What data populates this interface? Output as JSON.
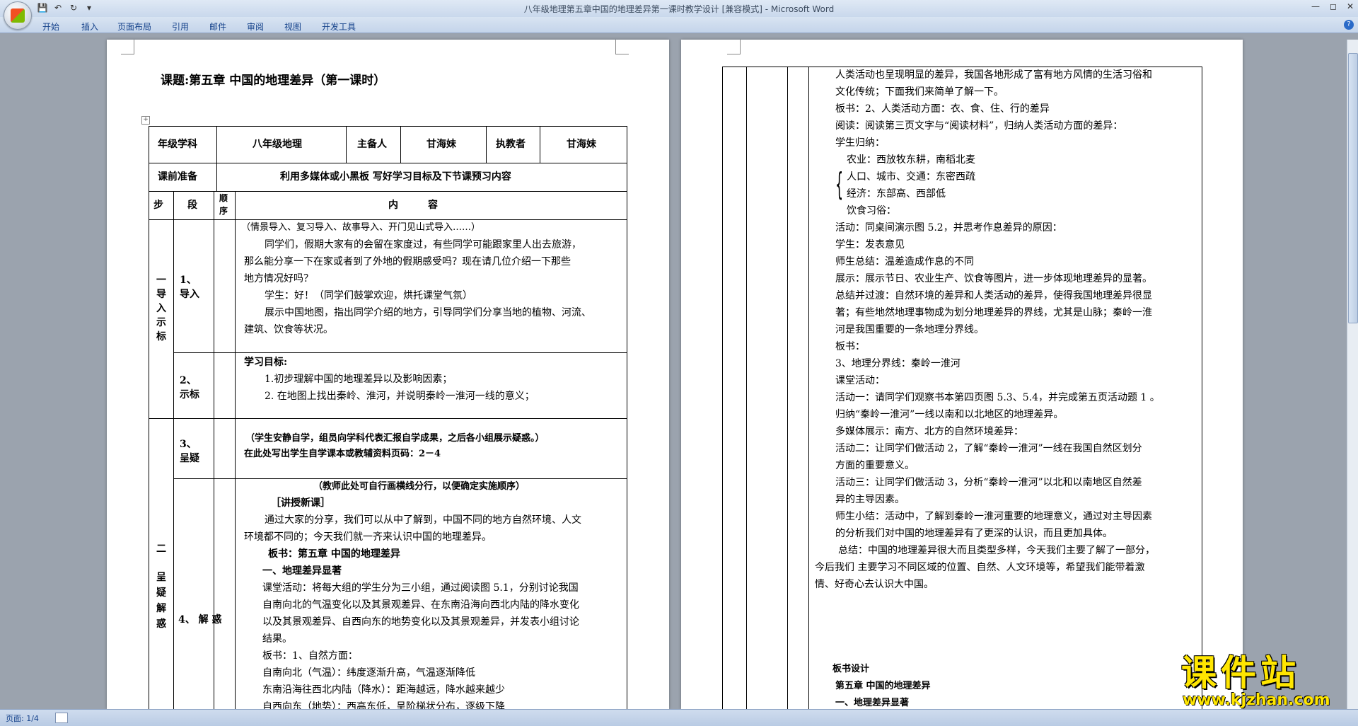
{
  "window": {
    "title": "八年级地理第五章中国的地理差异第一课时教学设计 [兼容模式] - Microsoft Word"
  },
  "ribbon": {
    "tabs": [
      "开始",
      "插入",
      "页面布局",
      "引用",
      "邮件",
      "审阅",
      "视图",
      "开发工具"
    ]
  },
  "doc": {
    "heading": "课题:第五章 中国的地理差异（第一课时）",
    "info_row": {
      "grade_label": "年级学科",
      "grade_value": "八年级地理",
      "preparer_label": "主备人",
      "preparer_value": "甘海妹",
      "teacher_label": "执教者",
      "teacher_value": "甘海妹"
    },
    "prep_row": {
      "label": "课前准备",
      "value": "利用多媒体或小黑板 写好学习目标及下节课预习内容"
    },
    "header_row": {
      "step": "步",
      "segment": "段",
      "order_1": "顺",
      "order_2": "序",
      "content": "内　　　容"
    },
    "phase1": [
      "一",
      "导",
      "入",
      "示",
      "标"
    ],
    "phase2": [
      "二",
      "呈",
      "疑",
      "解",
      "惑"
    ],
    "seg_import": [
      "1、",
      "导入"
    ],
    "seg_target": [
      "2、",
      "示标"
    ],
    "seg_doubt": [
      "3、",
      "呈疑"
    ],
    "seg_solve": "4、 解 惑",
    "import_lines": [
      "（情景导入、复习导入、故事导入、开门见山式导入……）",
      "同学们，假期大家有的会留在家度过，有些同学可能跟家里人出去旅游，",
      "那么能分享一下在家或者到了外地的假期感受吗？现在请几位介绍一下那些",
      "地方情况好吗？",
      "学生：好！（同学们鼓掌欢迎，烘托课堂气氛）",
      "展示中国地图，指出同学介绍的地方，引导同学们分享当地的植物、河流、",
      "建筑、饮食等状况。"
    ],
    "goals_title": "学习目标:",
    "goals": [
      "1.初步理解中国的地理差异以及影响因素；",
      "2. 在地图上找出秦岭、淮河，并说明秦岭一淮河一线的意义；"
    ],
    "doubt_lines": [
      "（学生安静自学，组员向学科代表汇报自学成果，之后各小组展示疑惑。）",
      "在此处写出学生自学课本或教辅资料页码：2－4"
    ],
    "solve_note": "（教师此处可自行画横线分行，以便确定实施顺序）",
    "solve_lines": [
      "［讲授新课］",
      "通过大家的分享，我们可以从中了解到，中国不同的地方自然环境、人文",
      "环境都不同的；今天我们就一齐来认识中国的地理差异。",
      "板书：第五章 中国的地理差异",
      "一、地理差异显著",
      "课堂活动：将每大组的学生分为三小组，通过阅读图 5.1，分别讨论我国",
      "自南向北的气温变化以及其景观差异、在东南沿海向西北内陆的降水变化",
      "以及其景观差异、自西向东的地势变化以及其景观差异，并发表小组讨论",
      "结果。",
      "板书：1、自然方面：",
      "自南向北（气温）：纬度逐渐升高，气温逐渐降低",
      "东南沿海往西北内陆（降水）：距海越远，降水越来越少",
      "自西向东（地势）：西高东低，呈阶梯状分布，逐级下降"
    ],
    "page2_lines": [
      "人类活动也呈现明显的差异，我国各地形成了富有地方风情的生活习俗和",
      "文化传统；下面我们来简单了解一下。",
      "板书：2、人类活动方面：衣、食、住、行的差异",
      "阅读：阅读第三页文字与“阅读材料”，归纳人类活动方面的差异：",
      "学生归纳：",
      "农业：西放牧东耕，南稻北麦",
      "人口、城市、交通：东密西疏",
      "经济：东部高、西部低",
      "饮食习俗：",
      "活动：同桌间演示图 5.2，并思考作息差异的原因：",
      "学生：发表意见",
      "师生总结：温差造成作息的不同",
      "展示：展示节日、农业生产、饮食等图片，进一步体现地理差异的显著。",
      "总结并过渡：自然环境的差异和人类活动的差异，使得我国地理差异很显",
      "著；有些地然地理事物成为划分地理差异的界线，尤其是山脉；秦岭一淮",
      "河是我国重要的一条地理分界线。",
      "板书：",
      "3、地理分界线：秦岭一淮河",
      "课堂活动：",
      "活动一：请同学们观察书本第四页图 5.3、5.4，并完成第五页活动题 1 。",
      "归纳“秦岭一淮河”一线以南和以北地区的地理差异。",
      "多媒体展示：南方、北方的自然环境差异：",
      "活动二：让同学们做活动 2，了解“秦岭一淮河”一线在我国自然区划分",
      "方面的重要意义。",
      "活动三：让同学们做活动 3，分析“秦岭一淮河”以北和以南地区自然差",
      "异的主导因素。",
      "师生小结：活动中，了解到秦岭一淮河重要的地理意义，通过对主导因素",
      "的分析我们对中国的地理差异有了更深的认识，而且更加具体。",
      "总结：中国的地理差异很大而且类型多样，今天我们主要了解了一部分，",
      "今后我们 主要学习不同区域的位置、自然、人文环境等，希望我们能带着激",
      "情、好奇心去认识大中国。"
    ],
    "board_title": "板书设计",
    "board_lines": [
      "第五章 中国的地理差异",
      "一、地理差异显著"
    ]
  },
  "status": {
    "page": "页面: 1/4"
  },
  "watermark": {
    "name": "课件站",
    "url": "www.kjzhan.com"
  }
}
